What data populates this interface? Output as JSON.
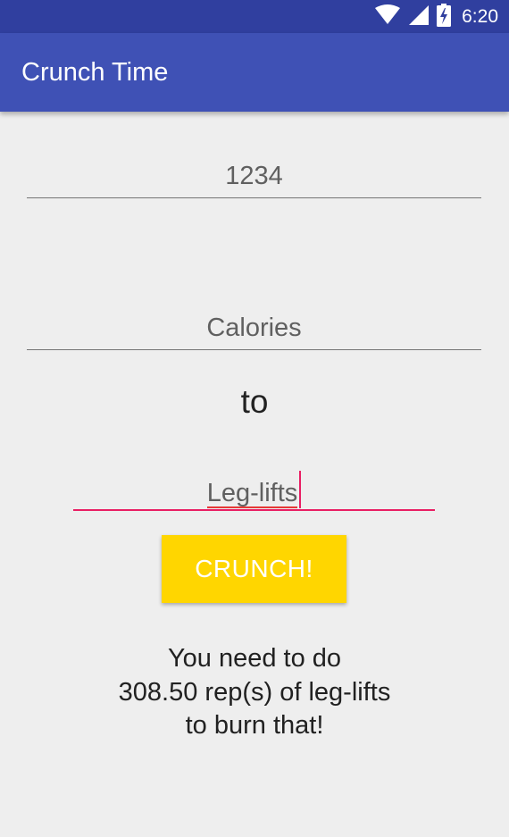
{
  "status_bar": {
    "time": "6:20",
    "icons": [
      "wifi-icon",
      "signal-icon",
      "battery-charging-icon"
    ]
  },
  "app_bar": {
    "title": "Crunch Time"
  },
  "form": {
    "amount_value": "1234",
    "unit_value": "Calories",
    "connector": "to",
    "exercise_value": "Leg-lifts",
    "button_label": "CRUNCH!"
  },
  "result": {
    "line1": "You need to do",
    "line2": "308.50 rep(s) of leg-lifts",
    "line3": "to burn that!"
  },
  "colors": {
    "primary": "#3f51b5",
    "primary_dark": "#303f9f",
    "accent": "#e91e63",
    "button": "#ffd600",
    "background": "#eeeeee"
  }
}
